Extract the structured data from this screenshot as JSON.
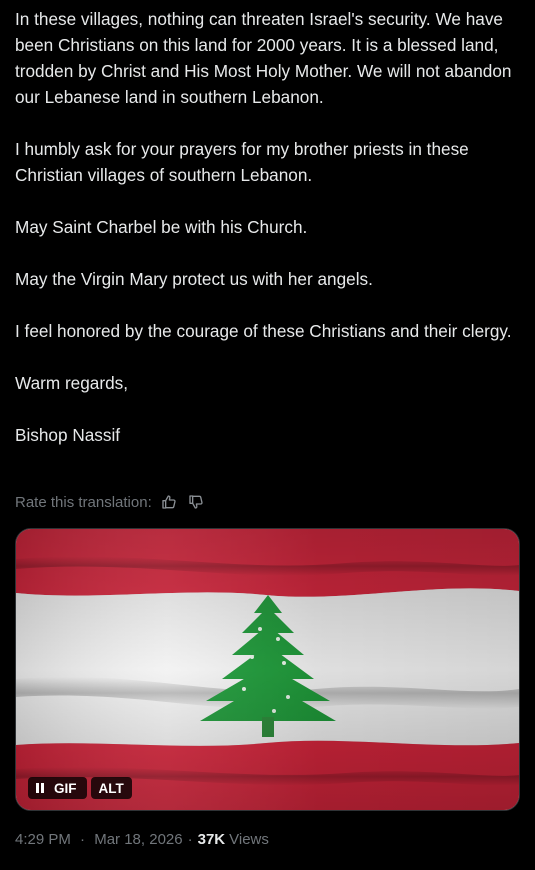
{
  "post": {
    "paragraphs": [
      "In these villages, nothing can threaten Israel's security. We have been Christians on this land for 2000 years. It is a blessed land, trodden by Christ and His Most Holy Mother. We will not abandon our Lebanese land in southern Lebanon.",
      "I humbly ask for your prayers for my brother priests in these Christian villages of southern Lebanon.",
      "May Saint Charbel be with his Church.",
      "May the Virgin Mary protect us with her angels.",
      "I feel honored by the courage of these Christians and their clergy.",
      "Warm regards,",
      "Bishop Nassif"
    ],
    "rate_label": "Rate this translation:",
    "rate_icons": [
      "thumbs-up-icon",
      "thumbs-down-icon"
    ],
    "media": {
      "badges": {
        "gif": "GIF",
        "alt": "ALT"
      },
      "colors": {
        "stripe_red": "#d6283f",
        "stripe_white": "#f4f4f4",
        "cedar_green": "#1f9a3a"
      }
    },
    "meta": {
      "time": "4:29 PM",
      "separator": "·",
      "date": "Mar 18, 2026",
      "views_count": "37K",
      "views_label": "Views"
    }
  }
}
